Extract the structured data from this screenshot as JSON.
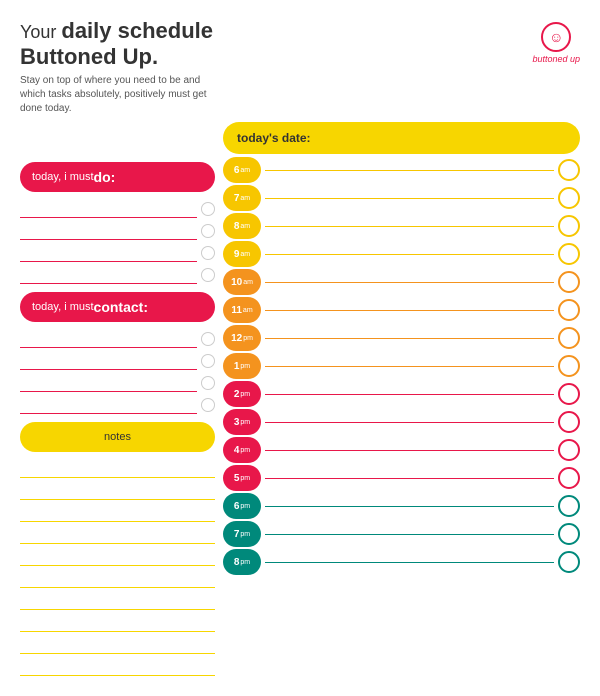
{
  "page": {
    "title_your": "Your ",
    "title_bold": "daily schedule",
    "title_line2": "Buttoned Up.",
    "subtitle": "Stay on top of where you need to be and which tasks absolutely, positively must get done today.",
    "logo_label": "buttoned up",
    "today_date_label": "today's date:",
    "do_label_regular": "today, i must ",
    "do_label_bold": "do:",
    "contact_label_regular": "today, i must ",
    "contact_label_bold": "contact:",
    "notes_label": "notes",
    "schedule": [
      {
        "time": "6",
        "suffix": "am",
        "color": "yellow"
      },
      {
        "time": "7",
        "suffix": "am",
        "color": "yellow"
      },
      {
        "time": "8",
        "suffix": "am",
        "color": "yellow"
      },
      {
        "time": "9",
        "suffix": "am",
        "color": "yellow"
      },
      {
        "time": "10",
        "suffix": "am",
        "color": "orange"
      },
      {
        "time": "11",
        "suffix": "am",
        "color": "orange"
      },
      {
        "time": "12",
        "suffix": "pm",
        "color": "orange"
      },
      {
        "time": "1",
        "suffix": "pm",
        "color": "orange"
      },
      {
        "time": "2",
        "suffix": "pm",
        "color": "red"
      },
      {
        "time": "3",
        "suffix": "pm",
        "color": "red"
      },
      {
        "time": "4",
        "suffix": "pm",
        "color": "red"
      },
      {
        "time": "5",
        "suffix": "pm",
        "color": "red"
      },
      {
        "time": "6",
        "suffix": "pm",
        "color": "teal"
      },
      {
        "time": "7",
        "suffix": "pm",
        "color": "teal"
      },
      {
        "time": "8",
        "suffix": "pm",
        "color": "teal"
      }
    ],
    "do_lines": 4,
    "contact_lines": 4,
    "notes_lines": 10
  }
}
